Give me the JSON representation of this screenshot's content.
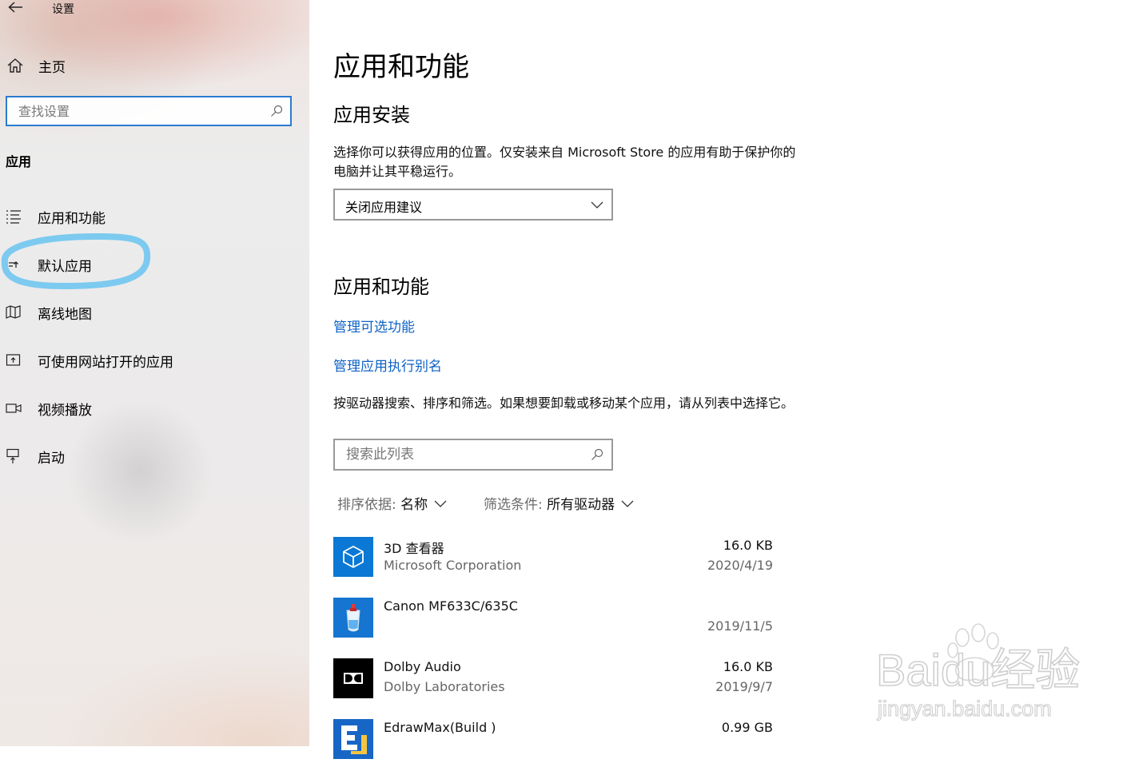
{
  "window": {
    "title": "设置"
  },
  "sidebar": {
    "home_label": "主页",
    "search_placeholder": "查找设置",
    "section": "应用",
    "items": [
      {
        "label": "应用和功能",
        "icon": "list-icon"
      },
      {
        "label": "默认应用",
        "icon": "default-apps-icon"
      },
      {
        "label": "离线地图",
        "icon": "map-icon"
      },
      {
        "label": "可使用网站打开的应用",
        "icon": "web-app-icon"
      },
      {
        "label": "视频播放",
        "icon": "video-icon"
      },
      {
        "label": "启动",
        "icon": "startup-icon"
      }
    ]
  },
  "main": {
    "title": "应用和功能",
    "install": {
      "heading": "应用安装",
      "description": "选择你可以获得应用的位置。仅安装来自 Microsoft Store 的应用有助于保护你的电脑并让其平稳运行。",
      "dropdown_value": "关闭应用建议"
    },
    "features": {
      "heading": "应用和功能",
      "link_optional": "管理可选功能",
      "link_alias": "管理应用执行别名",
      "description": "按驱动器搜索、排序和筛选。如果想要卸载或移动某个应用，请从列表中选择它。",
      "search_placeholder": "搜索此列表",
      "sort_label": "排序依据:",
      "sort_value": "名称",
      "filter_label": "筛选条件:",
      "filter_value": "所有驱动器"
    },
    "apps": [
      {
        "name": "3D 查看器",
        "publisher": "Microsoft Corporation",
        "size": "16.0 KB",
        "date": "2020/4/19"
      },
      {
        "name": "Canon MF633C/635C",
        "publisher": "",
        "size": "",
        "date": "2019/11/5"
      },
      {
        "name": "Dolby Audio",
        "publisher": "Dolby Laboratories",
        "size": "16.0 KB",
        "date": "2019/9/7"
      },
      {
        "name": "EdrawMax(Build )",
        "publisher": "",
        "size": "0.99 GB",
        "date": ""
      }
    ]
  },
  "watermark": {
    "brand": "Baidu经验",
    "url": "jingyan.baidu.com"
  },
  "colors": {
    "accent": "#0f62c4",
    "search_border": "#2b7bd0",
    "highlight": "#7ccaf0"
  }
}
